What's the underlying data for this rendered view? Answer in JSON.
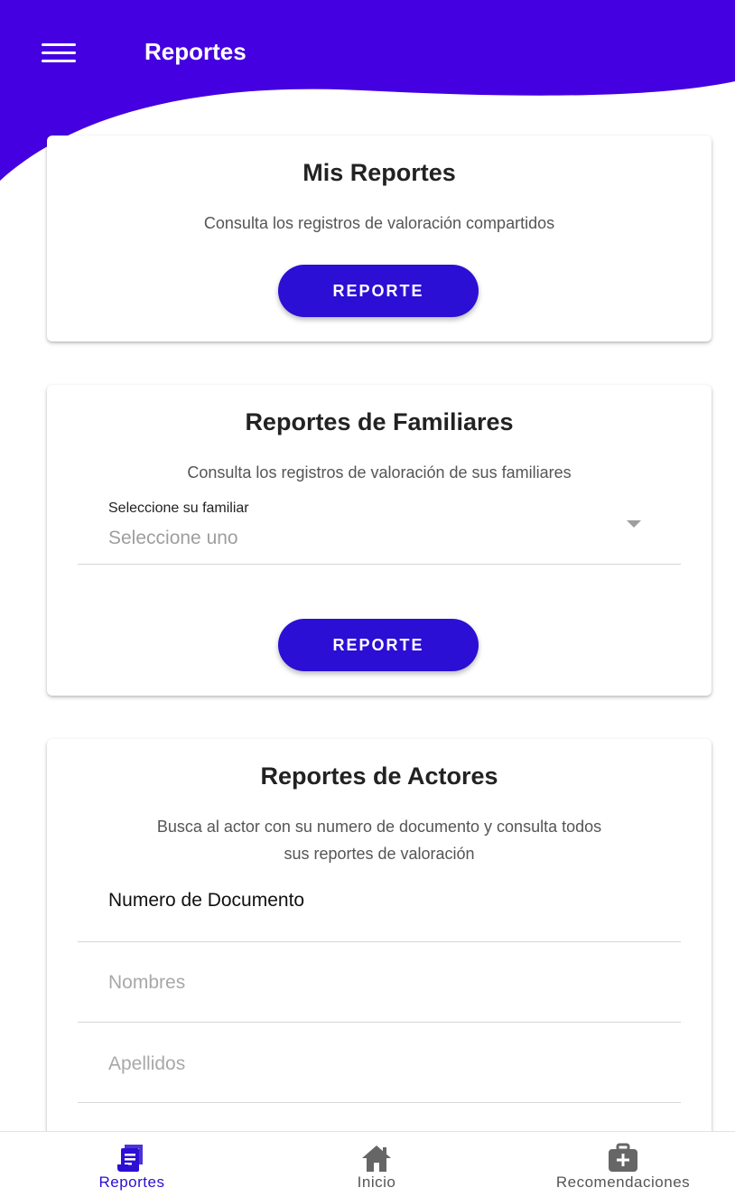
{
  "header": {
    "title": "Reportes",
    "color": "#4400e0"
  },
  "cards": {
    "mis_reportes": {
      "title": "Mis Reportes",
      "subtitle": "Consulta los registros de valoración compartidos",
      "button_label": "REPORTE"
    },
    "familiares": {
      "title": "Reportes de Familiares",
      "subtitle": "Consulta los registros de valoración de sus familiares",
      "select_label": "Seleccione su familiar",
      "select_value": "Seleccione uno",
      "button_label": "REPORTE"
    },
    "actores": {
      "title": "Reportes de Actores",
      "subtitle_line1": "Busca al actor con su numero de documento y consulta todos",
      "subtitle_line2": "sus reportes de valoración",
      "document_value": "Numero de Documento",
      "names_placeholder": "Nombres",
      "surnames_placeholder": "Apellidos"
    }
  },
  "bottom_nav": {
    "items": [
      {
        "label": "Reportes",
        "icon": "report-icon",
        "active": true
      },
      {
        "label": "Inicio",
        "icon": "home-icon",
        "active": false
      },
      {
        "label": "Recomendaciones",
        "icon": "medical-kit-icon",
        "active": false
      }
    ]
  },
  "colors": {
    "accent": "#2b0fd4",
    "header": "#4400e0",
    "inactive_icon": "#666666"
  }
}
